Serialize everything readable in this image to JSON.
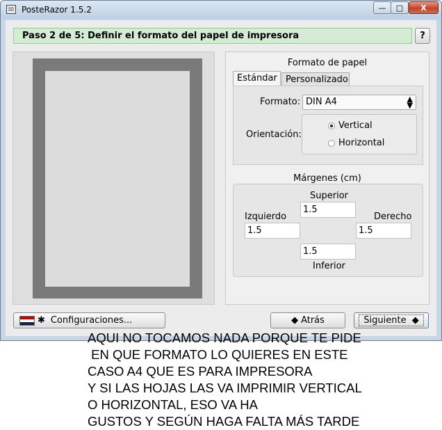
{
  "window": {
    "title": "PosteRazor 1.5.2",
    "controls": {
      "minimize": "—",
      "maximize": "□",
      "close": "X"
    }
  },
  "step": {
    "title": "Paso 2 de 5: Definir el formato del papel de impresora",
    "help_label": "?"
  },
  "paper_format": {
    "group_title": "Formato de papel",
    "tabs": [
      {
        "label": "Estándar",
        "active": true
      },
      {
        "label": "Personalizado",
        "active": false
      }
    ],
    "format_label": "Formato:",
    "format_value": "DIN A4",
    "orientation_label": "Orientación:",
    "orientation_options": [
      {
        "label": "Vertical",
        "selected": true
      },
      {
        "label": "Horizontal",
        "selected": false
      }
    ]
  },
  "margins": {
    "group_title": "Márgenes (cm)",
    "top_label": "Superior",
    "top_value": "1.5",
    "left_label": "Izquierdo",
    "left_value": "1.5",
    "right_label": "Derecho",
    "right_value": "1.5",
    "bottom_label": "Inferior",
    "bottom_value": "1.5"
  },
  "footer": {
    "settings_label": "Configuraciones...",
    "back_label": "Atrás",
    "next_label": "Siguiente"
  },
  "annotation": {
    "lines": [
      "AQUI NO TOCAMOS NADA PORQUE TE PIDE",
      " EN QUE FORMATO LO QUIERES EN ESTE",
      "CASO A4 QUE ES PARA IMPRESORA",
      "Y SI LAS HOJAS LAS VA IMPRIMIR VERTICAL",
      "O HORIZONTAL, ESO VA HA",
      "GUSTOS Y SEGÚN HAGA FALTA MÁS TARDE"
    ]
  },
  "colors": {
    "header_bg": "#d4ecd4",
    "paper_border": "#7a7a7a",
    "close_button": "#c4432a"
  }
}
